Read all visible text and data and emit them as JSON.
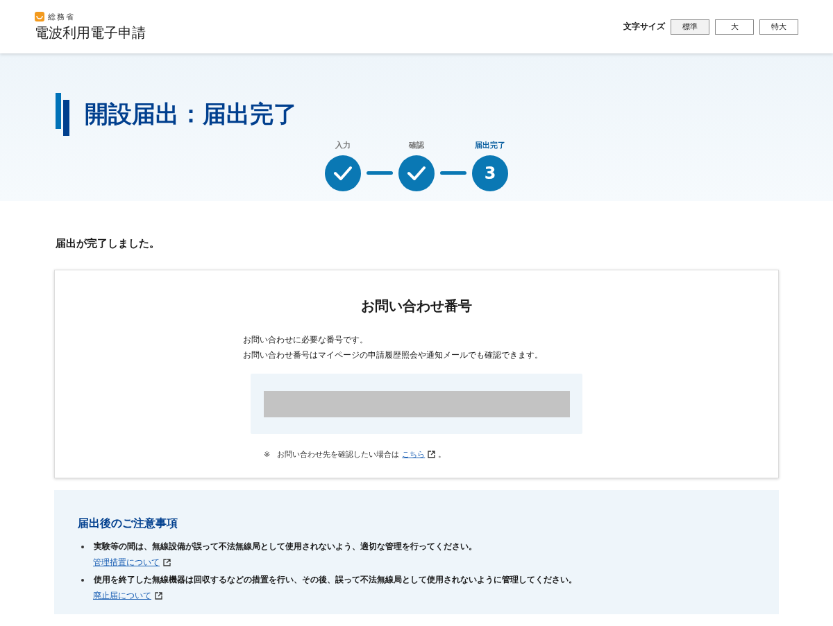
{
  "header": {
    "ministry": "総務省",
    "service": "電波利用電子申請",
    "font_size": {
      "label": "文字サイズ",
      "options": [
        {
          "label": "標準",
          "selected": true
        },
        {
          "label": "大",
          "selected": false
        },
        {
          "label": "特大",
          "selected": false
        }
      ]
    }
  },
  "page_title": "開設届出：届出完了",
  "steps": [
    {
      "label": "入力",
      "kind": "done"
    },
    {
      "label": "確認",
      "kind": "done"
    },
    {
      "label": "届出完了",
      "kind": "current",
      "number": "3"
    }
  ],
  "message": "届出が完了しました。",
  "inquiry": {
    "title": "お問い合わせ番号",
    "lines": [
      "お問い合わせに必要な番号です。",
      "お問い合わせ番号はマイページの申請履歴照会や通知メールでも確認できます。"
    ],
    "note_mark": "※",
    "note": "お問い合わせ先を確認したい場合は",
    "note_link": "こちら",
    "note_end": "。"
  },
  "notices": {
    "title": "届出後のご注意事項",
    "items": [
      {
        "text": "実験等の間は、無線設備が誤って不法無線局として使用されないよう、適切な管理を行ってください。",
        "link": "管理措置について"
      },
      {
        "text": "使用を終了した無線機器は回収するなどの措置を行い、その後、誤って不法無線局として使用されないように管理してください。",
        "link": "廃止届について"
      }
    ]
  }
}
